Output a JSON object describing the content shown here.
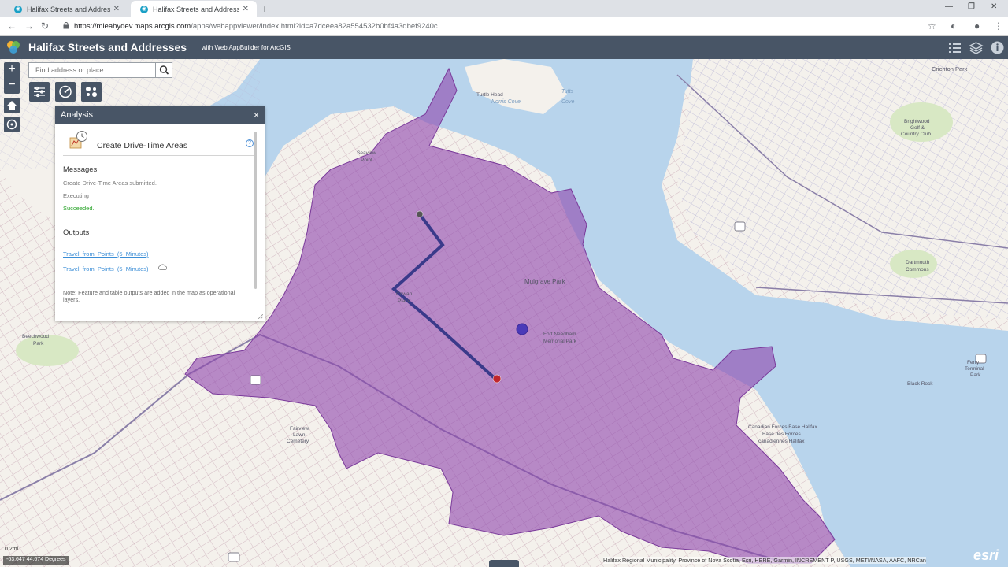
{
  "browser": {
    "tabs": [
      {
        "title": "Halifax Streets and Addresses - W",
        "active": false
      },
      {
        "title": "Halifax Streets and Addresses",
        "active": true
      }
    ],
    "url_host": "https://mleahydev.maps.arcgis.com",
    "url_path": "/apps/webappviewer/index.html?id=a7dceea82a554532b0bf4a3dbef9240c"
  },
  "app": {
    "title": "Halifax Streets and Addresses",
    "subtitle": "with Web AppBuilder for ArcGIS",
    "accent": "#485566",
    "icons": [
      "list-icon",
      "layers-icon",
      "info-icon"
    ]
  },
  "map": {
    "zoom_in": "+",
    "zoom_out": "−",
    "search_placeholder": "Find address or place",
    "drive_time_fill": "#8e44ad",
    "water_color": "#b8d4ec",
    "labels": [
      "Tufts",
      "Cove",
      "Turtle Head",
      "Norris Cove",
      "Seaview",
      "Point",
      "Mulgrave Park",
      "Fort Needham",
      "Memorial Park",
      "Cowan",
      "Place",
      "Black Rock",
      "Canadian Forces Base Halifax",
      "Base des Forces",
      "canadiennes Halifax",
      "Brightwood",
      "Golf &",
      "Country Club",
      "Dartmouth",
      "Commons",
      "Ferry",
      "Terminal",
      "Park",
      "Fairview",
      "Lawn",
      "Cemetery",
      "Beechwood",
      "Park",
      "Crichton Park"
    ],
    "coordinate_readout": "-63.647 44.674 Degrees",
    "scale_label": "0.2mi",
    "attribution": "Halifax Regional Municipality, Province of Nova Scotia, Esri, HERE, Garmin, INCREMENT P, USGS, METI/NASA, AAFC, NRCan",
    "esri_logo": "esri"
  },
  "analysis": {
    "header": "Analysis",
    "close": "×",
    "tool_title": "Create Drive-Time Areas",
    "help": "?",
    "messages_heading": "Messages",
    "messages": [
      {
        "text": "Create Drive-Time Areas submitted.",
        "status": "info"
      },
      {
        "text": "Executing",
        "status": "info"
      },
      {
        "text": "Succeeded.",
        "status": "success"
      }
    ],
    "outputs_heading": "Outputs",
    "outputs": [
      {
        "label": "Travel_from_Points_(5_Minutes)"
      },
      {
        "label": "Travel_from_Points_(5_Minutes)"
      }
    ],
    "note": "Note: Feature and table outputs are added in the map as operational layers."
  }
}
